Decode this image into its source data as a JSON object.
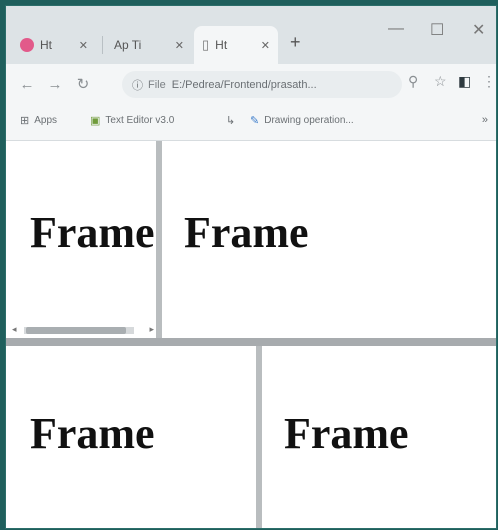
{
  "browser": {
    "tabs": [
      {
        "label": "Ht",
        "active": false,
        "favicon_color": "#e25a8a"
      },
      {
        "label": "Ap Ti",
        "active": false,
        "favicon_color": "#c9ced1"
      },
      {
        "label": "Ht",
        "active": true,
        "favicon_color": "#ffffff"
      }
    ],
    "new_tab": "+",
    "address": {
      "scheme": "File",
      "url": "E:/Pedrea/Frontend/prasath..."
    },
    "bookmarks": [
      {
        "label": "Apps",
        "icon": "apps-grid-icon"
      },
      {
        "label": "Text Editor v3.0",
        "icon": "text-editor-icon"
      },
      {
        "label": "",
        "icon": "bookmark-arrow-icon"
      },
      {
        "label": "Drawing operation...",
        "icon": "drawing-icon"
      }
    ]
  },
  "frames": {
    "top_left": "Frame",
    "top_right": "Frame",
    "bottom_left": "Frame",
    "bottom_right": "Frame"
  }
}
